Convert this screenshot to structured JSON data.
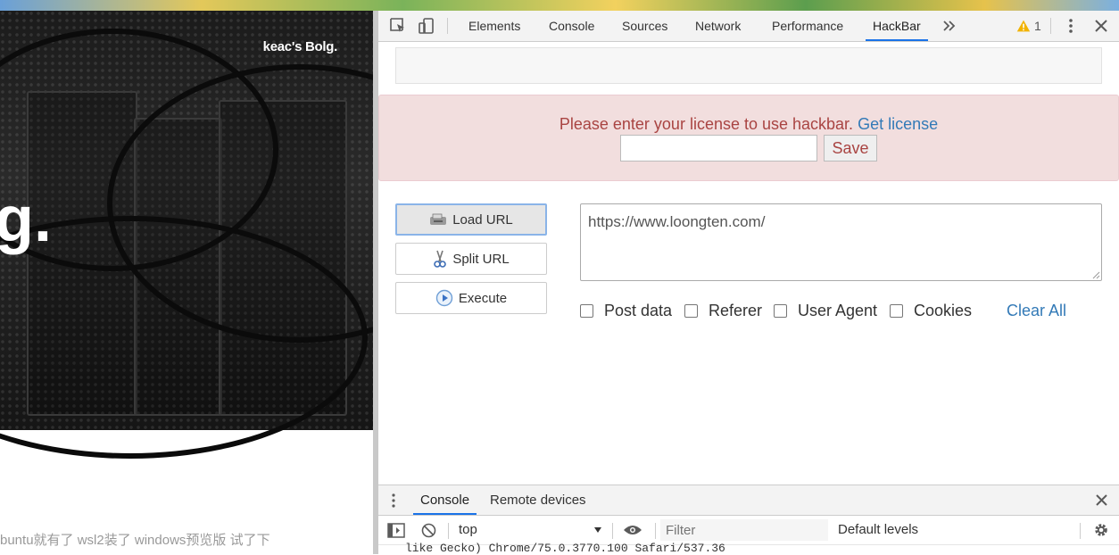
{
  "page": {
    "blog_title": "keac's Bolg.",
    "hero_glyph": "g.",
    "caption": "buntu就有了 wsl2装了 windows预览版 试了下"
  },
  "devtools": {
    "tabs": [
      "Elements",
      "Console",
      "Sources",
      "Network",
      "Performance",
      "HackBar"
    ],
    "active_tab": "HackBar",
    "more_tabs_icon": "chevrons-right-icon",
    "warning_count": "1",
    "accent_color": "#1a73e8"
  },
  "hackbar": {
    "license_message": "Please enter your license to use hackbar.",
    "license_link": "Get license",
    "license_placeholder": "",
    "save_label": "Save",
    "buttons": {
      "load_url": "Load URL",
      "split_url": "Split URL",
      "execute": "Execute"
    },
    "url_value": "https://www.loongten.com/",
    "options": [
      "Post data",
      "Referer",
      "User Agent",
      "Cookies"
    ],
    "clear_all": "Clear All",
    "error_bg": "#f2dede",
    "error_text": "#a94442",
    "link_color": "#337ab7"
  },
  "drawer": {
    "tabs": [
      "Console",
      "Remote devices"
    ],
    "active_tab": "Console",
    "context": "top",
    "filter_placeholder": "Filter",
    "levels": "Default levels",
    "log_line": "like Gecko) Chrome/75.0.3770.100 Safari/537.36"
  }
}
